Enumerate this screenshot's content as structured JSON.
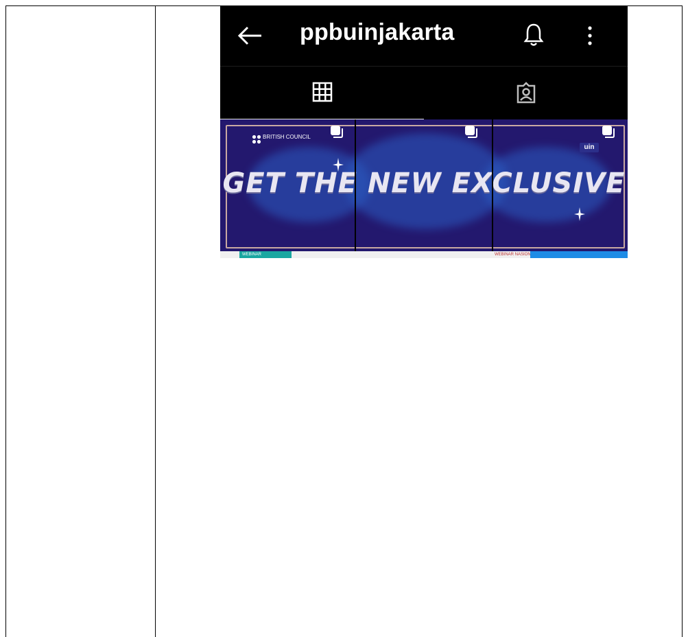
{
  "profile": {
    "username": "ppbuinjakarta"
  },
  "icons": {
    "back": "arrow-left",
    "notifications": "bell",
    "more": "more-vertical",
    "grid_tab": "grid",
    "tagged_tab": "tagged-person"
  },
  "posts": {
    "banner_headline": "GET THE NEW EXCLUSIVE",
    "brand_left": "BRITISH COUNCIL",
    "brand_right": "uin",
    "strip_left": "WEBINAR",
    "strip_right": "WEBINAR NASIONAL"
  },
  "colors": {
    "app_background": "#000000",
    "banner_background": "#23186e",
    "banner_frame": "#c9a9a2",
    "teal_accent": "#1aa7a1",
    "blue_accent": "#1e8ce6"
  }
}
